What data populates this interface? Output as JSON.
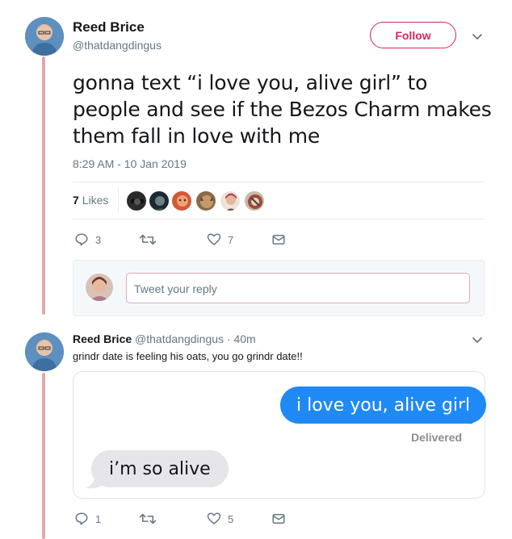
{
  "main_tweet": {
    "author_name": "Reed Brice",
    "author_handle": "@thatdangdingus",
    "follow_label": "Follow",
    "text": "gonna text “i love you, alive girl” to people and see if the Bezos Charm makes them fall in love with me",
    "timestamp": "8:29 AM - 10 Jan 2019",
    "likes_count": "7",
    "likes_label": "Likes",
    "reply_count": "3",
    "retweet_count": "",
    "like_count": "7"
  },
  "reply_composer": {
    "placeholder": "Tweet your reply"
  },
  "reply_tweet": {
    "author_name": "Reed Brice",
    "author_handle": "@thatdangdingus",
    "time": "· 40m",
    "text": "grindr date is feeling his oats, you go grindr date!!",
    "sent_message": "i love you, alive girl",
    "delivered_label": "Delivered",
    "received_message": "i’m so alive",
    "reply_count": "1",
    "retweet_count": "",
    "like_count": "5"
  },
  "colors": {
    "accent": "#e0245e",
    "thread_line": "#e0a8a8",
    "imessage_blue": "#1f8af5",
    "imessage_gray": "#e5e5ea",
    "muted_text": "#657786"
  },
  "icons": [
    "chevron-down-icon",
    "reply-icon",
    "retweet-icon",
    "heart-icon",
    "message-icon"
  ]
}
